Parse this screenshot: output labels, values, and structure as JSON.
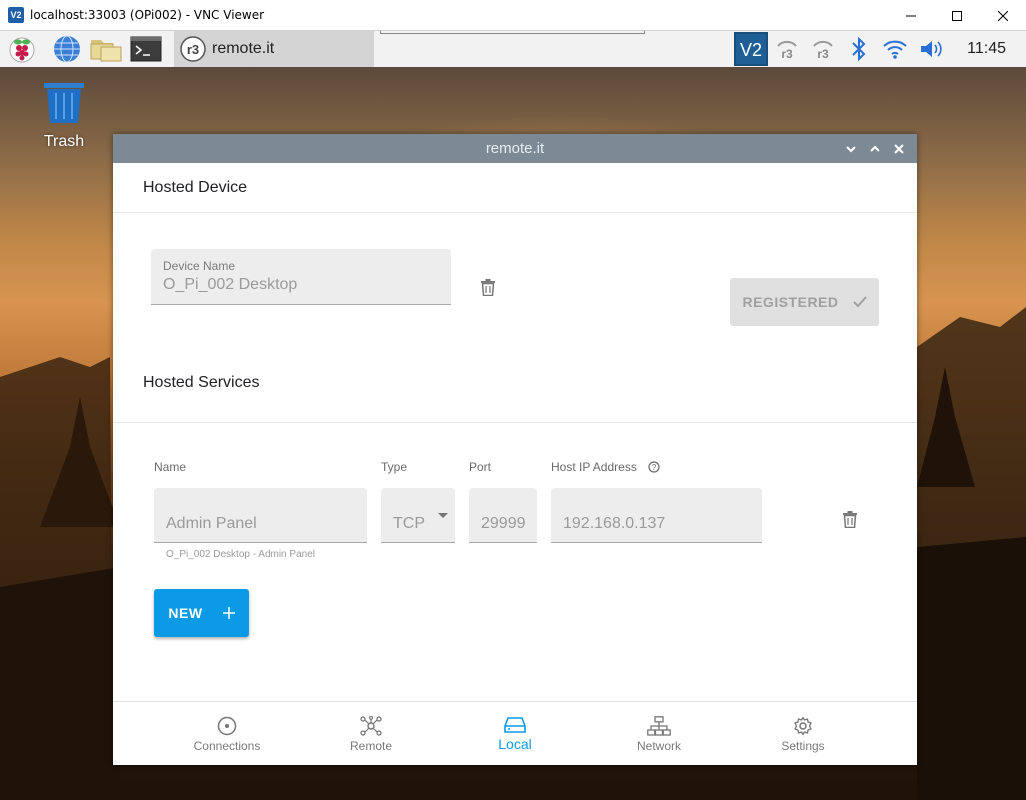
{
  "vnc": {
    "logo_text": "V2",
    "title": "localhost:33003 (OPi002) - VNC Viewer"
  },
  "taskbar": {
    "app_label": "remote.it",
    "clock": "11:45"
  },
  "desktop": {
    "trash_label": "Trash"
  },
  "window": {
    "title": "remote.it",
    "hosted_device": {
      "heading": "Hosted Device",
      "device_name_label": "Device Name",
      "device_name_value": "O_Pi_002 Desktop",
      "registered_label": "REGISTERED"
    },
    "hosted_services": {
      "heading": "Hosted Services",
      "columns": {
        "name": "Name",
        "type": "Type",
        "port": "Port",
        "host_ip": "Host IP Address"
      },
      "service": {
        "name": "Admin Panel",
        "type": "TCP",
        "port": "29999",
        "host_ip": "192.168.0.137",
        "helper": "O_Pi_002 Desktop - Admin Panel"
      },
      "new_button_label": "NEW"
    },
    "nav": [
      {
        "label": "Connections",
        "icon": "connections-icon",
        "active": false
      },
      {
        "label": "Remote",
        "icon": "remote-icon",
        "active": false
      },
      {
        "label": "Local",
        "icon": "local-icon",
        "active": true
      },
      {
        "label": "Network",
        "icon": "network-icon",
        "active": false
      },
      {
        "label": "Settings",
        "icon": "settings-icon",
        "active": false
      }
    ]
  },
  "colors": {
    "accent": "#0b9ae6",
    "window_titlebar": "#7c8a95",
    "field_bg": "#ededed"
  }
}
